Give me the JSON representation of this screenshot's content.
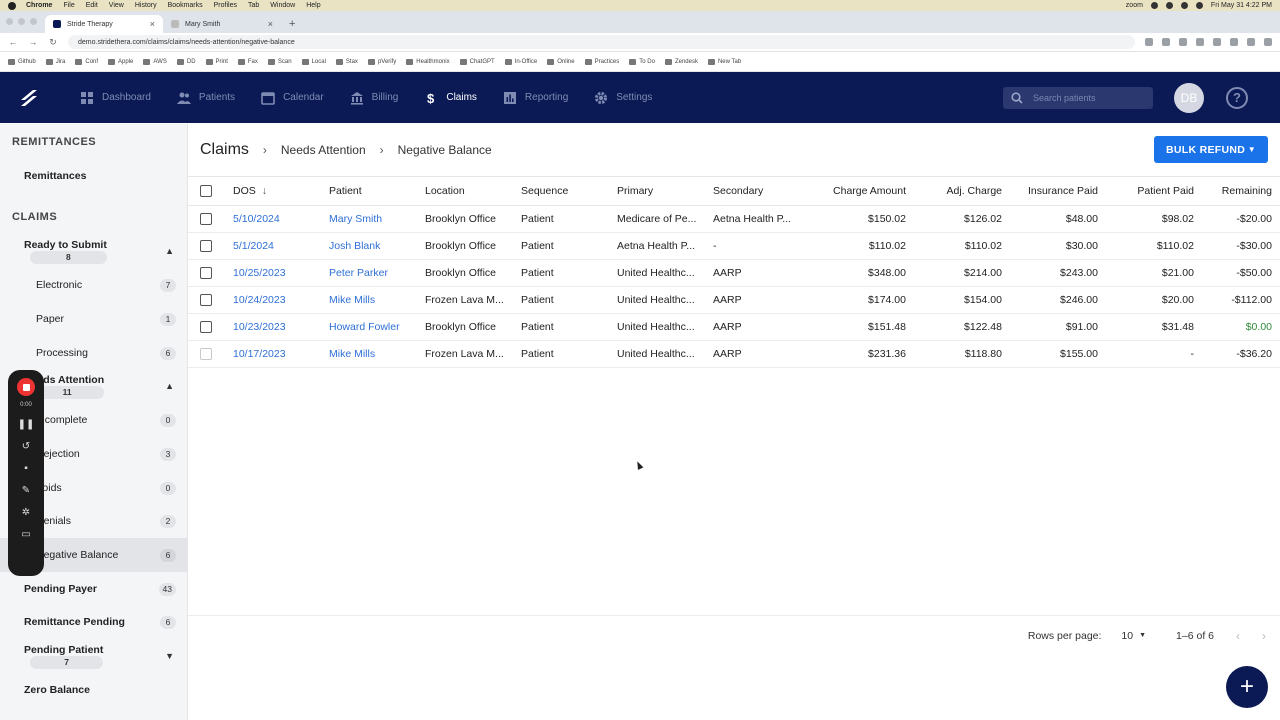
{
  "mac": {
    "menu": [
      "Chrome",
      "File",
      "Edit",
      "View",
      "History",
      "Bookmarks",
      "Profiles",
      "Tab",
      "Window",
      "Help"
    ],
    "zoom": "zoom",
    "clock": "Fri May 31  4:22 PM"
  },
  "browser": {
    "tabs": [
      {
        "title": "Stride Therapy",
        "close": "×"
      },
      {
        "title": "Mary Smith",
        "close": "×"
      }
    ],
    "new_tab": "+",
    "url": "demo.stridethera.com/claims/claims/needs-attention/negative-balance",
    "bookmarks": [
      "Github",
      "Jira",
      "Conf",
      "Apple",
      "AWS",
      "DD",
      "Print",
      "Fax",
      "Scan",
      "Local",
      "Stax",
      "pVerify",
      "Healthmonix",
      "ChatGPT",
      "In-Office",
      "Online",
      "Practices",
      "To Do",
      "Zendesk",
      "New Tab"
    ]
  },
  "app": {
    "nav": [
      {
        "label": "Dashboard",
        "icon": "dashboard-icon"
      },
      {
        "label": "Patients",
        "icon": "patients-icon"
      },
      {
        "label": "Calendar",
        "icon": "calendar-icon"
      },
      {
        "label": "Billing",
        "icon": "bank-icon"
      },
      {
        "label": "Claims",
        "icon": "dollar-icon"
      },
      {
        "label": "Reporting",
        "icon": "chart-icon"
      },
      {
        "label": "Settings",
        "icon": "gear-icon"
      }
    ],
    "search_placeholder": "Search patients",
    "avatar": "DB",
    "help": "?"
  },
  "sidebar": {
    "remittances_title": "REMITTANCES",
    "remittances_item": "Remittances",
    "claims_title": "CLAIMS",
    "items": [
      {
        "label": "Ready to Submit",
        "count": "8",
        "chevron": "▲"
      },
      {
        "label": "Electronic",
        "count": "7"
      },
      {
        "label": "Paper",
        "count": "1"
      },
      {
        "label": "Processing",
        "count": "6"
      },
      {
        "label": "Needs Attention",
        "count": "11",
        "chevron": "▲"
      },
      {
        "label": "Incomplete",
        "count": "0"
      },
      {
        "label": "Rejection",
        "count": "3"
      },
      {
        "label": "Voids",
        "count": "0"
      },
      {
        "label": "Denials",
        "count": "2"
      },
      {
        "label": "Negative Balance",
        "count": "6"
      },
      {
        "label": "Pending Payer",
        "count": "43"
      },
      {
        "label": "Remittance Pending",
        "count": "6"
      },
      {
        "label": "Pending Patient",
        "count": "7",
        "chevron": "▼"
      },
      {
        "label": "Zero Balance"
      }
    ]
  },
  "recorder": {
    "time": "0:00"
  },
  "content": {
    "breadcrumb": [
      "Claims",
      "Needs Attention",
      "Negative Balance"
    ],
    "bulk_refund": "BULK REFUND",
    "columns": [
      "DOS",
      "Patient",
      "Location",
      "Sequence",
      "Primary",
      "Secondary",
      "Charge Amount",
      "Adj. Charge",
      "Insurance Paid",
      "Patient Paid",
      "Remaining"
    ],
    "rows": [
      {
        "dos": "5/10/2024",
        "patient": "Mary Smith",
        "location": "Brooklyn Office",
        "sequence": "Patient",
        "primary": "Medicare of Pe...",
        "secondary": "Aetna Health P...",
        "charge": "$150.02",
        "adj": "$126.02",
        "ins_paid": "$48.00",
        "pat_paid": "$98.02",
        "remaining": "-$20.00"
      },
      {
        "dos": "5/1/2024",
        "patient": "Josh Blank",
        "location": "Brooklyn Office",
        "sequence": "Patient",
        "primary": "Aetna Health P...",
        "secondary": "-",
        "charge": "$110.02",
        "adj": "$110.02",
        "ins_paid": "$30.00",
        "pat_paid": "$110.02",
        "remaining": "-$30.00"
      },
      {
        "dos": "10/25/2023",
        "patient": "Peter Parker",
        "location": "Brooklyn Office",
        "sequence": "Patient",
        "primary": "United Healthc...",
        "secondary": "AARP",
        "charge": "$348.00",
        "adj": "$214.00",
        "ins_paid": "$243.00",
        "pat_paid": "$21.00",
        "remaining": "-$50.00"
      },
      {
        "dos": "10/24/2023",
        "patient": "Mike Mills",
        "location": "Frozen Lava M...",
        "sequence": "Patient",
        "primary": "United Healthc...",
        "secondary": "AARP",
        "charge": "$174.00",
        "adj": "$154.00",
        "ins_paid": "$246.00",
        "pat_paid": "$20.00",
        "remaining": "-$112.00"
      },
      {
        "dos": "10/23/2023",
        "patient": "Howard Fowler",
        "location": "Brooklyn Office",
        "sequence": "Patient",
        "primary": "United Healthc...",
        "secondary": "AARP",
        "charge": "$151.48",
        "adj": "$122.48",
        "ins_paid": "$91.00",
        "pat_paid": "$31.48",
        "remaining": "$0.00"
      },
      {
        "dos": "10/17/2023",
        "patient": "Mike Mills",
        "location": "Frozen Lava M...",
        "sequence": "Patient",
        "primary": "United Healthc...",
        "secondary": "AARP",
        "charge": "$231.36",
        "adj": "$118.80",
        "ins_paid": "$155.00",
        "pat_paid": "-",
        "remaining": "-$36.20"
      }
    ],
    "rows_per_page_label": "Rows per page:",
    "rows_per_page": "10",
    "range": "1–6 of 6",
    "prev": "‹",
    "next": "›",
    "fab": "+",
    "colors": {
      "positive_remaining": "#2f8a3c",
      "link": "#2e6fd6",
      "header": "#0b1a55",
      "primary_button": "#1a73e8"
    }
  }
}
